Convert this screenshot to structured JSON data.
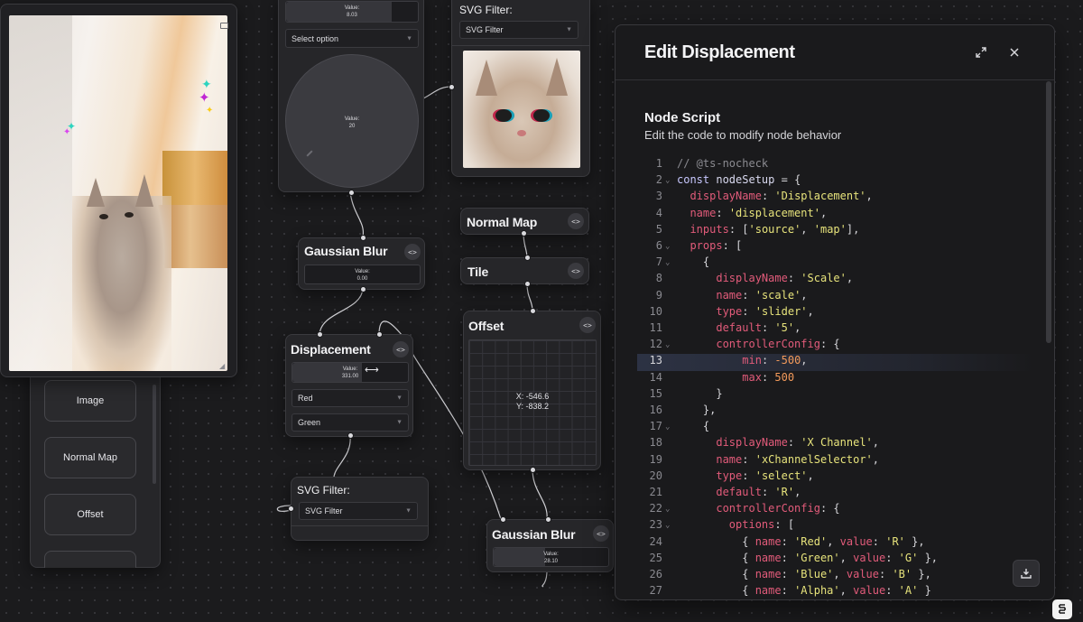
{
  "canvas": {
    "top_node": {
      "value_label": "Value:",
      "value": "8.03",
      "select_placeholder": "Select option",
      "dial_label": "Value:",
      "dial_value": "20"
    },
    "svg_filter_top": {
      "title": "SVG Filter:",
      "select_value": "SVG Filter"
    },
    "gaussian_blur_1": {
      "title": "Gaussian Blur",
      "code_icon": "<>",
      "value_label": "Value:",
      "value": "0.00"
    },
    "displacement": {
      "title": "Displacement",
      "code_icon": "<>",
      "value_label": "Value:",
      "value": "331.00",
      "value_fraction": 0.6,
      "x_channel": "Red",
      "y_channel": "Green"
    },
    "svg_filter_bottom": {
      "title": "SVG Filter:",
      "select_value": "SVG Filter"
    },
    "normal_map": {
      "title": "Normal Map",
      "code_icon": "<>"
    },
    "tile": {
      "title": "Tile",
      "code_icon": "<>"
    },
    "offset": {
      "title": "Offset",
      "code_icon": "<>",
      "x_readout": "X: -546.6",
      "y_readout": "Y: -838.2"
    },
    "gaussian_blur_2": {
      "title": "Gaussian Blur",
      "code_icon": "<>",
      "value_label": "Value:",
      "value": "28.10"
    }
  },
  "sidebar": {
    "items": [
      {
        "label": "Image"
      },
      {
        "label": "Normal Map"
      },
      {
        "label": "Offset"
      },
      {
        "label": ""
      }
    ]
  },
  "modal": {
    "title": "Edit Displacement",
    "section_title": "Node Script",
    "section_subtitle": "Edit the code to modify node behavior",
    "active_line": 13,
    "code_lines": [
      {
        "n": "1",
        "fold": false,
        "tokens": [
          [
            "comment",
            "// @ts-nocheck"
          ]
        ]
      },
      {
        "n": "2",
        "fold": true,
        "tokens": [
          [
            "kw",
            "const "
          ],
          [
            "id",
            "nodeSetup"
          ],
          [
            "punc",
            " = {"
          ]
        ]
      },
      {
        "n": "3",
        "fold": false,
        "tokens": [
          [
            "punc",
            "  "
          ],
          [
            "prop",
            "displayName"
          ],
          [
            "punc",
            ": "
          ],
          [
            "str",
            "'Displacement'"
          ],
          [
            "punc",
            ","
          ]
        ]
      },
      {
        "n": "4",
        "fold": false,
        "tokens": [
          [
            "punc",
            "  "
          ],
          [
            "prop",
            "name"
          ],
          [
            "punc",
            ": "
          ],
          [
            "str",
            "'displacement'"
          ],
          [
            "punc",
            ","
          ]
        ]
      },
      {
        "n": "5",
        "fold": false,
        "tokens": [
          [
            "punc",
            "  "
          ],
          [
            "prop",
            "inputs"
          ],
          [
            "punc",
            ": ["
          ],
          [
            "str",
            "'source'"
          ],
          [
            "punc",
            ", "
          ],
          [
            "str",
            "'map'"
          ],
          [
            "punc",
            "],"
          ]
        ]
      },
      {
        "n": "6",
        "fold": true,
        "tokens": [
          [
            "punc",
            "  "
          ],
          [
            "prop",
            "props"
          ],
          [
            "punc",
            ": ["
          ]
        ]
      },
      {
        "n": "7",
        "fold": true,
        "tokens": [
          [
            "punc",
            "    {"
          ]
        ]
      },
      {
        "n": "8",
        "fold": false,
        "tokens": [
          [
            "punc",
            "      "
          ],
          [
            "prop",
            "displayName"
          ],
          [
            "punc",
            ": "
          ],
          [
            "str",
            "'Scale'"
          ],
          [
            "punc",
            ","
          ]
        ]
      },
      {
        "n": "9",
        "fold": false,
        "tokens": [
          [
            "punc",
            "      "
          ],
          [
            "prop",
            "name"
          ],
          [
            "punc",
            ": "
          ],
          [
            "str",
            "'scale'"
          ],
          [
            "punc",
            ","
          ]
        ]
      },
      {
        "n": "10",
        "fold": false,
        "tokens": [
          [
            "punc",
            "      "
          ],
          [
            "prop",
            "type"
          ],
          [
            "punc",
            ": "
          ],
          [
            "str",
            "'slider'"
          ],
          [
            "punc",
            ","
          ]
        ]
      },
      {
        "n": "11",
        "fold": false,
        "tokens": [
          [
            "punc",
            "      "
          ],
          [
            "prop",
            "default"
          ],
          [
            "punc",
            ": "
          ],
          [
            "str",
            "'5'"
          ],
          [
            "punc",
            ","
          ]
        ]
      },
      {
        "n": "12",
        "fold": true,
        "tokens": [
          [
            "punc",
            "      "
          ],
          [
            "prop",
            "controllerConfig"
          ],
          [
            "punc",
            ": {"
          ]
        ]
      },
      {
        "n": "13",
        "fold": false,
        "tokens": [
          [
            "punc",
            "          "
          ],
          [
            "prop",
            "min"
          ],
          [
            "punc",
            ": "
          ],
          [
            "num",
            "-500"
          ],
          [
            "punc",
            ","
          ]
        ]
      },
      {
        "n": "14",
        "fold": false,
        "tokens": [
          [
            "punc",
            "          "
          ],
          [
            "prop",
            "max"
          ],
          [
            "punc",
            ": "
          ],
          [
            "num",
            "500"
          ]
        ]
      },
      {
        "n": "15",
        "fold": false,
        "tokens": [
          [
            "punc",
            "      }"
          ]
        ]
      },
      {
        "n": "16",
        "fold": false,
        "tokens": [
          [
            "punc",
            "    },"
          ]
        ]
      },
      {
        "n": "17",
        "fold": true,
        "tokens": [
          [
            "punc",
            "    {"
          ]
        ]
      },
      {
        "n": "18",
        "fold": false,
        "tokens": [
          [
            "punc",
            "      "
          ],
          [
            "prop",
            "displayName"
          ],
          [
            "punc",
            ": "
          ],
          [
            "str",
            "'X Channel'"
          ],
          [
            "punc",
            ","
          ]
        ]
      },
      {
        "n": "19",
        "fold": false,
        "tokens": [
          [
            "punc",
            "      "
          ],
          [
            "prop",
            "name"
          ],
          [
            "punc",
            ": "
          ],
          [
            "str",
            "'xChannelSelector'"
          ],
          [
            "punc",
            ","
          ]
        ]
      },
      {
        "n": "20",
        "fold": false,
        "tokens": [
          [
            "punc",
            "      "
          ],
          [
            "prop",
            "type"
          ],
          [
            "punc",
            ": "
          ],
          [
            "str",
            "'select'"
          ],
          [
            "punc",
            ","
          ]
        ]
      },
      {
        "n": "21",
        "fold": false,
        "tokens": [
          [
            "punc",
            "      "
          ],
          [
            "prop",
            "default"
          ],
          [
            "punc",
            ": "
          ],
          [
            "str",
            "'R'"
          ],
          [
            "punc",
            ","
          ]
        ]
      },
      {
        "n": "22",
        "fold": true,
        "tokens": [
          [
            "punc",
            "      "
          ],
          [
            "prop",
            "controllerConfig"
          ],
          [
            "punc",
            ": {"
          ]
        ]
      },
      {
        "n": "23",
        "fold": true,
        "tokens": [
          [
            "punc",
            "        "
          ],
          [
            "prop",
            "options"
          ],
          [
            "punc",
            ": ["
          ]
        ]
      },
      {
        "n": "24",
        "fold": false,
        "tokens": [
          [
            "punc",
            "          { "
          ],
          [
            "prop",
            "name"
          ],
          [
            "punc",
            ": "
          ],
          [
            "str",
            "'Red'"
          ],
          [
            "punc",
            ", "
          ],
          [
            "prop",
            "value"
          ],
          [
            "punc",
            ": "
          ],
          [
            "str",
            "'R'"
          ],
          [
            "punc",
            " },"
          ]
        ]
      },
      {
        "n": "25",
        "fold": false,
        "tokens": [
          [
            "punc",
            "          { "
          ],
          [
            "prop",
            "name"
          ],
          [
            "punc",
            ": "
          ],
          [
            "str",
            "'Green'"
          ],
          [
            "punc",
            ", "
          ],
          [
            "prop",
            "value"
          ],
          [
            "punc",
            ": "
          ],
          [
            "str",
            "'G'"
          ],
          [
            "punc",
            " },"
          ]
        ]
      },
      {
        "n": "26",
        "fold": false,
        "tokens": [
          [
            "punc",
            "          { "
          ],
          [
            "prop",
            "name"
          ],
          [
            "punc",
            ": "
          ],
          [
            "str",
            "'Blue'"
          ],
          [
            "punc",
            ", "
          ],
          [
            "prop",
            "value"
          ],
          [
            "punc",
            ": "
          ],
          [
            "str",
            "'B'"
          ],
          [
            "punc",
            " },"
          ]
        ]
      },
      {
        "n": "27",
        "fold": false,
        "tokens": [
          [
            "punc",
            "          { "
          ],
          [
            "prop",
            "name"
          ],
          [
            "punc",
            ": "
          ],
          [
            "str",
            "'Alpha'"
          ],
          [
            "punc",
            ", "
          ],
          [
            "prop",
            "value"
          ],
          [
            "punc",
            ": "
          ],
          [
            "str",
            "'A'"
          ],
          [
            "punc",
            " }"
          ]
        ]
      }
    ]
  },
  "icons": {
    "expand": "expand-icon",
    "close": "close-icon",
    "download": "download-icon",
    "brand": "brand-logo-icon",
    "fold": "fold-chevron-icon"
  },
  "colors": {
    "canvas_bg": "#1b1b1d",
    "node_bg": "#262629",
    "string": "#e7e37b",
    "property": "#e25b7a",
    "number": "#f39a5b"
  }
}
